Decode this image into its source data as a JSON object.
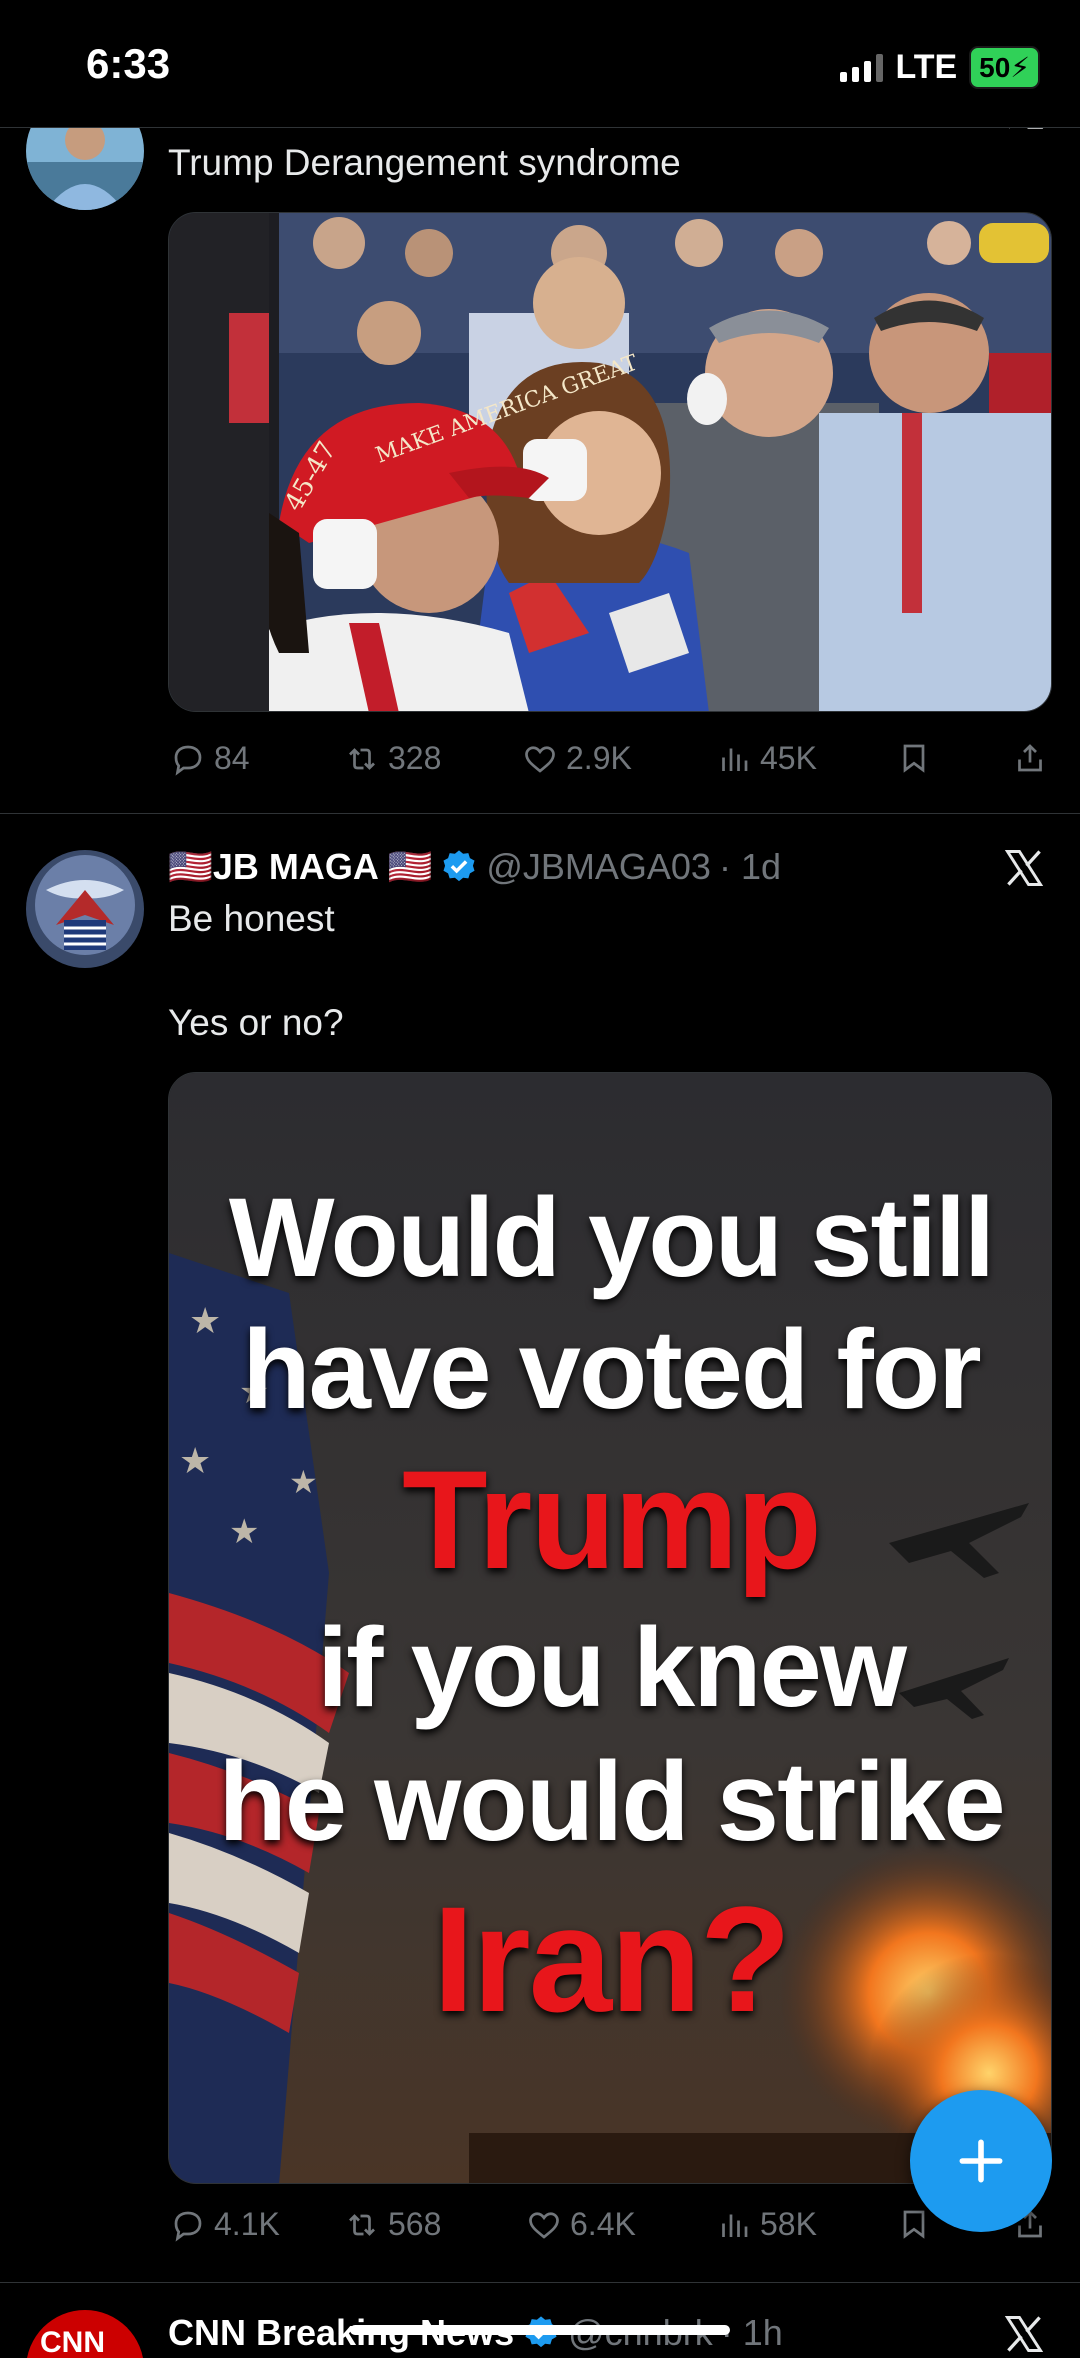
{
  "status_bar": {
    "time": "6:33",
    "network": "LTE",
    "battery": "50"
  },
  "tweet1": {
    "text": "Trump Derangement syndrome",
    "image_caption": "Audience members with white patches over their ears at a rally; red cap reads MAKE AMERICA GREAT AGAIN 45-47",
    "cap_text": "MAKE AMERICA GREAT",
    "cap_number": "45-47",
    "stats": {
      "replies": "84",
      "reposts": "328",
      "likes": "2.9K",
      "views": "45K"
    }
  },
  "tweet2": {
    "name": "🇺🇸JB MAGA 🇺🇸",
    "handle": "@JBMAGA03",
    "time": "· 1d",
    "text_line1": "Be honest",
    "text_line2": "Yes or no?",
    "meme": {
      "line1": "Would you still",
      "line2": "have voted for",
      "line3": "Trump",
      "line4": "if you knew",
      "line5": "he would strike",
      "line6": "Iran?"
    },
    "stats": {
      "replies": "4.1K",
      "reposts": "568",
      "likes": "6.4K",
      "views": "58K"
    }
  },
  "tweet3": {
    "name": "CNN Breaking News",
    "handle": "@cnnbrk",
    "time": "· 1h"
  },
  "colors": {
    "accent": "#1d9bf0",
    "meme_red": "#e8161b",
    "battery_green": "#30d158"
  },
  "icons": [
    "reply-icon",
    "repost-icon",
    "like-icon",
    "views-icon",
    "bookmark-icon",
    "share-icon",
    "x-logo-icon",
    "verified-icon",
    "plus-icon"
  ]
}
